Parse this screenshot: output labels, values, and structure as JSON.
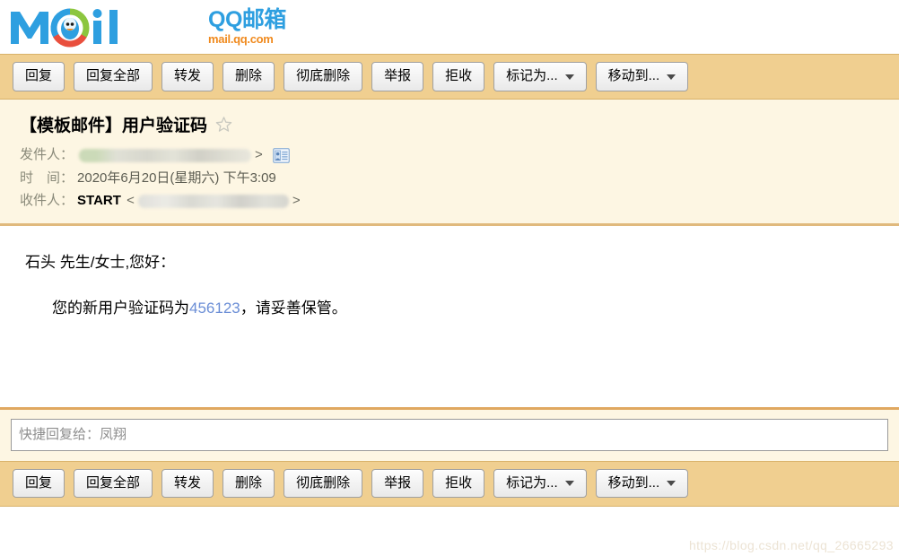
{
  "brand": {
    "logo_cn": "QQ邮箱",
    "logo_url": "mail.qq.com",
    "logo_wordmark": "Mail",
    "logo_icon_name": "qq-penguin-logo"
  },
  "toolbar": {
    "buttons": [
      {
        "label": "回复",
        "dropdown": false
      },
      {
        "label": "回复全部",
        "dropdown": false
      },
      {
        "label": "转发",
        "dropdown": false
      },
      {
        "label": "删除",
        "dropdown": false
      },
      {
        "label": "彻底删除",
        "dropdown": false
      },
      {
        "label": "举报",
        "dropdown": false
      },
      {
        "label": "拒收",
        "dropdown": false
      },
      {
        "label": "标记为...",
        "dropdown": true
      },
      {
        "label": "移动到...",
        "dropdown": true
      }
    ]
  },
  "mail": {
    "subject": "【模板邮件】用户验证码",
    "star_state": "unstarred",
    "sender_label": "发件人：",
    "sender_value": "",
    "sender_redacted": true,
    "date_label": "时　间：",
    "date_value": "2020年6月20日(星期六) 下午3:09",
    "recipient_label": "收件人：",
    "recipient_name": "START",
    "recipient_value": "",
    "recipient_redacted": true,
    "body": {
      "greeting": "石头 先生/女士,您好：",
      "code_prefix": "您的新用户验证码为",
      "code": "456123",
      "code_suffix": "，请妥善保管。",
      "code_color": "#6b8ed6"
    }
  },
  "quick_reply": {
    "placeholder": "快捷回复给：凤翔",
    "value": ""
  },
  "watermark": {
    "text": "https://blog.csdn.net/qq_26665293"
  },
  "colors": {
    "toolbar_bg": "#f0cf90",
    "header_bg": "#fdf6e3",
    "divider": "#e0b97d",
    "accent_blue": "#2e9fe0",
    "accent_orange": "#f08a1e"
  }
}
